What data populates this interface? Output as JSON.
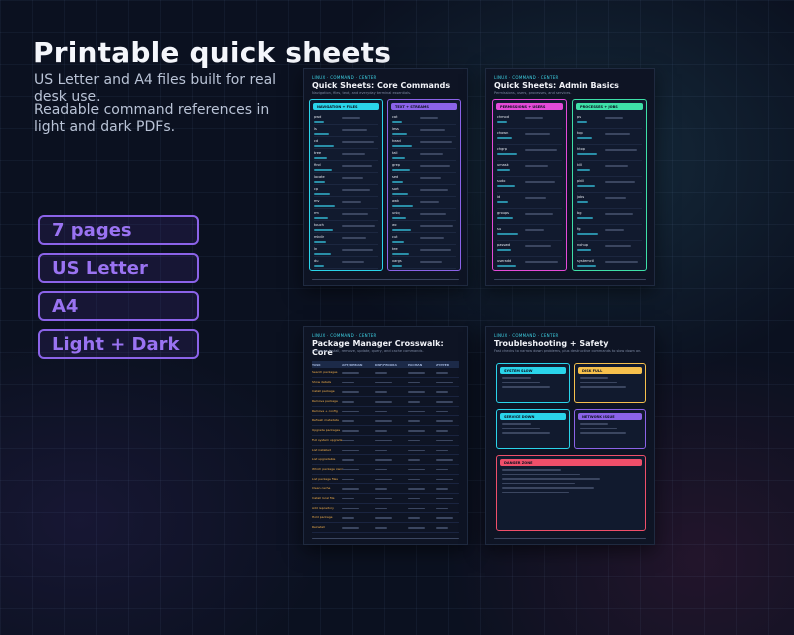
{
  "hero": {
    "title": "Printable quick sheets",
    "subtitle_1": "US Letter and A4 files built for real desk use.",
    "subtitle_2": "Readable command references in light and dark PDFs."
  },
  "badges": [
    "7 pages",
    "US Letter",
    "A4",
    "Light + Dark"
  ],
  "sheets": {
    "core": {
      "tag": "LINUX · COMMAND · CENTER",
      "title": "Quick Sheets: Core Commands",
      "desc": "Navigation, files, text, and everyday terminal essentials.",
      "col1_head": "NAVIGATION + FILES",
      "col2_head": "TEXT + STREAMS",
      "col1_cmds": [
        "pwd",
        "ls",
        "cd",
        "tree",
        "find",
        "locate",
        "cp",
        "mv",
        "rm",
        "touch",
        "mkdir",
        "ln",
        "du"
      ],
      "col2_cmds": [
        "cat",
        "less",
        "head",
        "tail",
        "grep",
        "sed",
        "sort",
        "awk",
        "uniq",
        "wc",
        "cut",
        "tee",
        "xargs"
      ]
    },
    "admin": {
      "tag": "LINUX · COMMAND · CENTER",
      "title": "Quick Sheets: Admin Basics",
      "desc": "Permissions, users, processes, and services.",
      "col1_head": "PERMISSIONS + USERS",
      "col2_head": "PROCESSES + JOBS",
      "col1_cmds": [
        "chmod",
        "chown",
        "chgrp",
        "umask",
        "sudo",
        "id",
        "groups",
        "su",
        "passwd",
        "useradd"
      ],
      "col2_cmds": [
        "ps",
        "top",
        "htop",
        "kill",
        "pkill",
        "jobs",
        "bg",
        "fg",
        "nohup",
        "systemctl"
      ]
    },
    "pkg": {
      "tag": "LINUX · COMMAND · CENTER",
      "title": "Package Manager Crosswalk: Core",
      "desc": "Common install, remove, update, query, and cache commands.",
      "columns": [
        "TASK",
        "APT/DEBIAN",
        "DNF/FEDORA",
        "PACMAN",
        "ZYPPER"
      ],
      "tasks": [
        "Search packages",
        "Show details",
        "Install package",
        "Remove package",
        "Remove + config",
        "Refresh metadata",
        "Upgrade packages",
        "Full system upgrade",
        "List installed",
        "List upgradable",
        "Which package owns",
        "List package files",
        "Clean cache",
        "Install local file",
        "Add repository",
        "Hold package",
        "Reinstall"
      ]
    },
    "trouble": {
      "tag": "LINUX · COMMAND · CENTER",
      "title": "Troubleshooting + Safety",
      "desc": "Fast checks to narrow down problems, plus destructive commands to slow down on.",
      "box1": "SYSTEM SLOW",
      "box2": "DISK FULL",
      "box3": "SERVICE DOWN",
      "box4": "NETWORK ISSUE",
      "box5": "DANGER ZONE"
    }
  },
  "colors": {
    "cyan": "#2ad4ea",
    "violet": "#8b63e8",
    "pink": "#e44ad8",
    "teal": "#3ee0a8",
    "amber": "#f6c04c",
    "red": "#ef4f6a",
    "blue": "#4f8cf2"
  }
}
